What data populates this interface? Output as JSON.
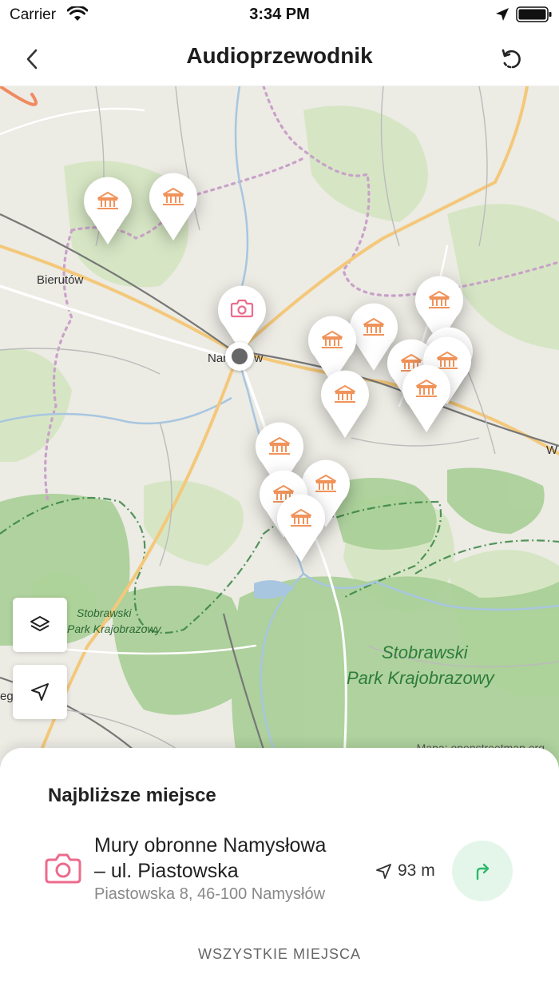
{
  "status_bar": {
    "carrier": "Carrier",
    "time": "3:34 PM"
  },
  "header": {
    "title": "Audioprzewodnik",
    "back_icon": "chevron-left-icon",
    "refresh_icon": "refresh-icon"
  },
  "map": {
    "labels": {
      "town_1": "Bierutów",
      "town_2": "Namysłów",
      "edge_right": "W",
      "edge_left": "eg",
      "park_small": "Stobrawski\nPark Krajobrazowy",
      "park_large_1": "Stobrawski",
      "park_large_2": "Park Krajobrazowy"
    },
    "attribution": "Mapa: openstreetmap.org",
    "marker_types": {
      "museum": "museum-icon",
      "camera": "camera-icon"
    },
    "controls": {
      "layers": "layers-icon",
      "locate": "navigation-arrow-icon"
    }
  },
  "nearest": {
    "heading": "Najbliższe miejsce",
    "name_line1": "Mury obronne Namysłowa",
    "name_line2": "– ul. Piastowska",
    "address": "Piastowska 8, 46-100 Namysłów",
    "distance": "93 m",
    "all_places_label": "WSZYSTKIE MIEJSCA"
  },
  "colors": {
    "marker_accent": "#f0935a",
    "camera_accent": "#ec6b8c",
    "route_green": "#2fb86b",
    "park_green": "#2d7d3a"
  }
}
